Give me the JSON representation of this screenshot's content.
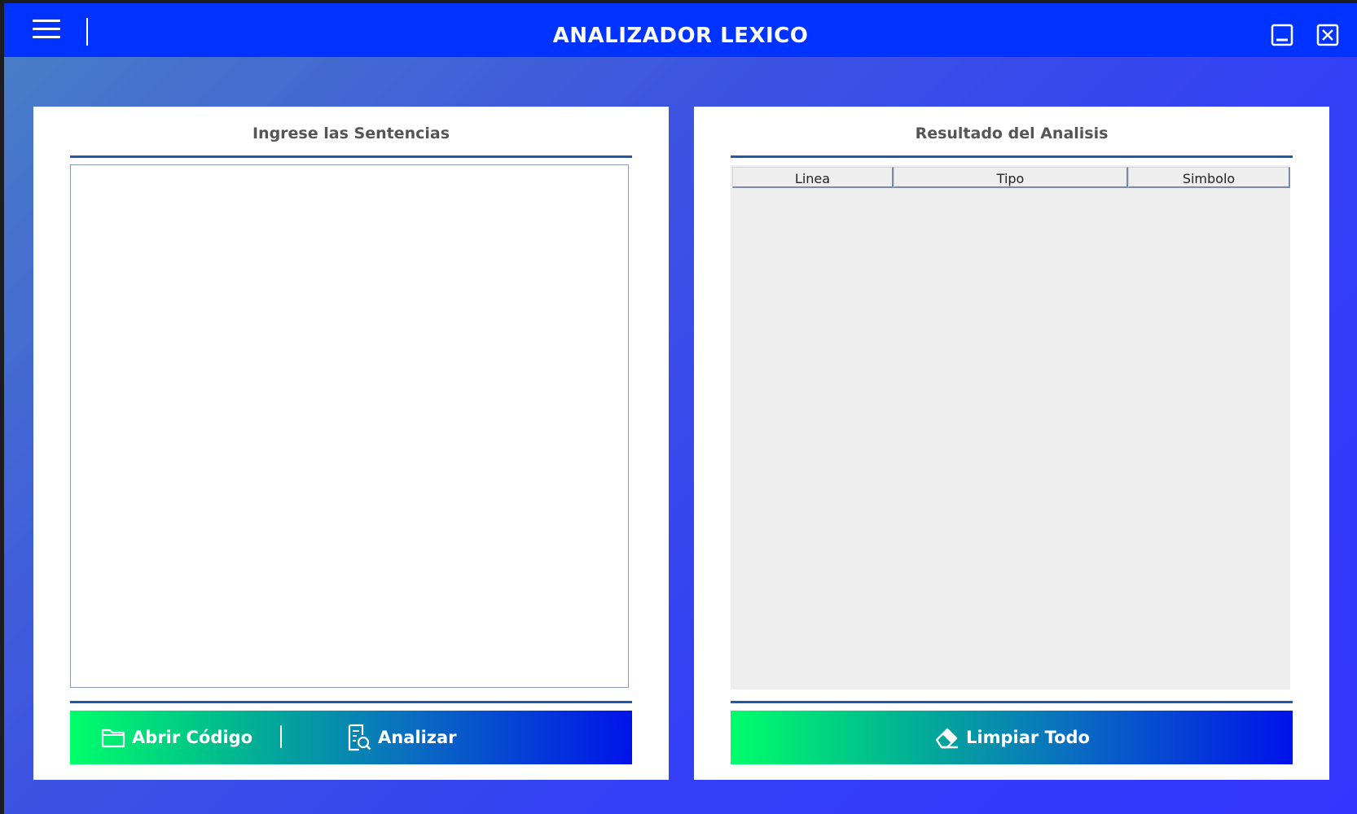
{
  "window": {
    "title": "ANALIZADOR LEXICO",
    "controls": {
      "minimize_icon": "minimize-icon",
      "close_icon": "close-icon",
      "menu_icon": "hamburger-icon"
    }
  },
  "left_panel": {
    "title": "Ingrese las Sentencias",
    "editor_value": "",
    "buttons": {
      "open": {
        "label": "Abrir Código",
        "icon": "folder-icon"
      },
      "analyze": {
        "label": "Analizar",
        "icon": "analyze-document-icon"
      }
    }
  },
  "right_panel": {
    "title": "Resultado del Analisis",
    "table": {
      "columns": [
        "Linea",
        "Tipo",
        "Simbolo"
      ],
      "rows": []
    },
    "buttons": {
      "clear": {
        "label": "Limpiar Todo",
        "icon": "eraser-icon"
      }
    }
  },
  "colors": {
    "titlebar": "#0033ff",
    "rule": "#1f5aa8",
    "button_gradient_start": "#00ff6a",
    "button_gradient_end": "#0013ea",
    "panel_title_text": "#555555"
  }
}
